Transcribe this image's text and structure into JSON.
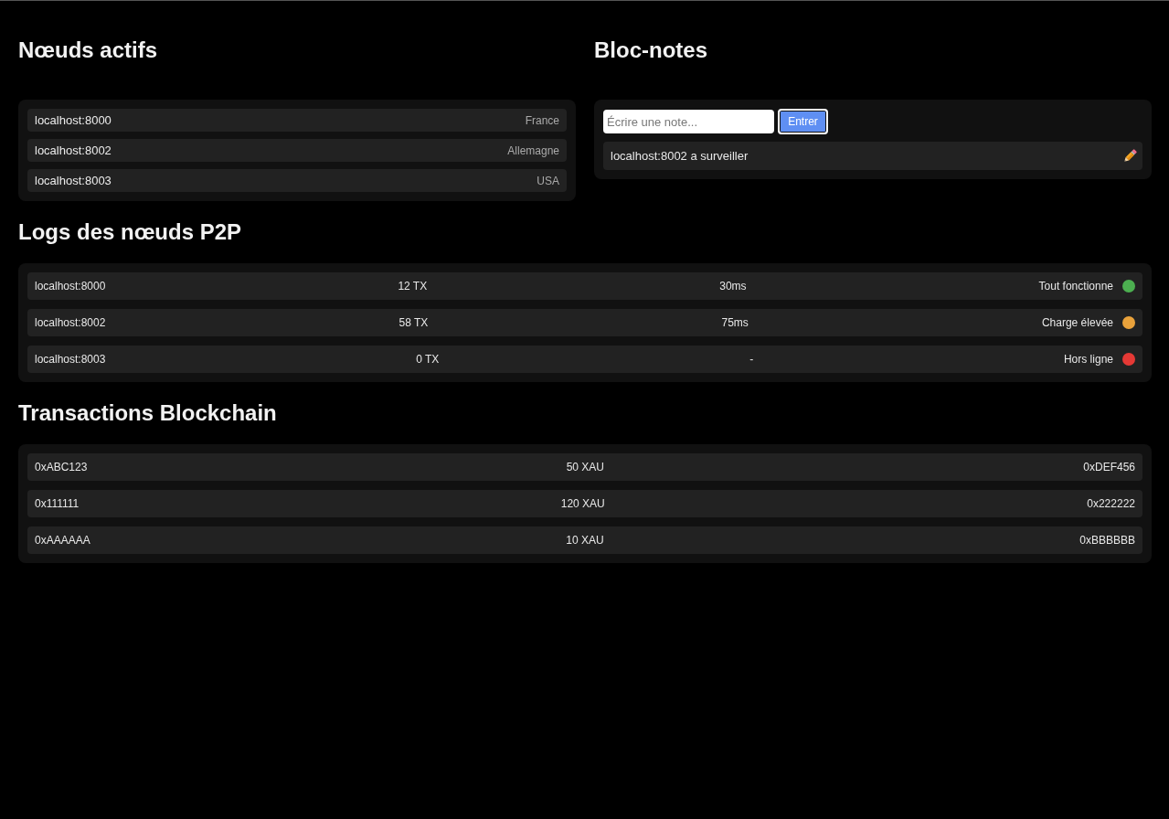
{
  "active_nodes": {
    "title": "Nœuds actifs",
    "nodes": [
      {
        "address": "localhost:8000",
        "location": "France"
      },
      {
        "address": "localhost:8002",
        "location": "Allemagne"
      },
      {
        "address": "localhost:8003",
        "location": "USA"
      }
    ]
  },
  "notepad": {
    "title": "Bloc-notes",
    "input": {
      "placeholder": "Écrire une note..."
    },
    "submit_button": {
      "label": "Entrer",
      "focused": true
    },
    "notes": [
      {
        "text": "localhost:8002 a surveiller"
      }
    ]
  },
  "p2p_logs": {
    "title": "Logs des nœuds P2P",
    "rows": [
      {
        "node": "localhost:8000",
        "transactions": "12 TX",
        "latency": "30ms",
        "status": "Tout fonctionne",
        "color": "#4caf50"
      },
      {
        "node": "localhost:8002",
        "transactions": "58 TX",
        "latency": "75ms",
        "status": "Charge élevée",
        "color": "#e9a23b"
      },
      {
        "node": "localhost:8003",
        "transactions": "0 TX",
        "latency": "-",
        "status": "Hors ligne",
        "color": "#e53935"
      }
    ]
  },
  "transactions": {
    "title": "Transactions Blockchain",
    "rows": [
      {
        "from": "0xABC123",
        "amount": "50 XAU",
        "to": "0xDEF456"
      },
      {
        "from": "0x111111",
        "amount": "120 XAU",
        "to": "0x222222"
      },
      {
        "from": "0xAAAAAA",
        "amount": "10 XAU",
        "to": "0xBBBBBB"
      }
    ]
  }
}
